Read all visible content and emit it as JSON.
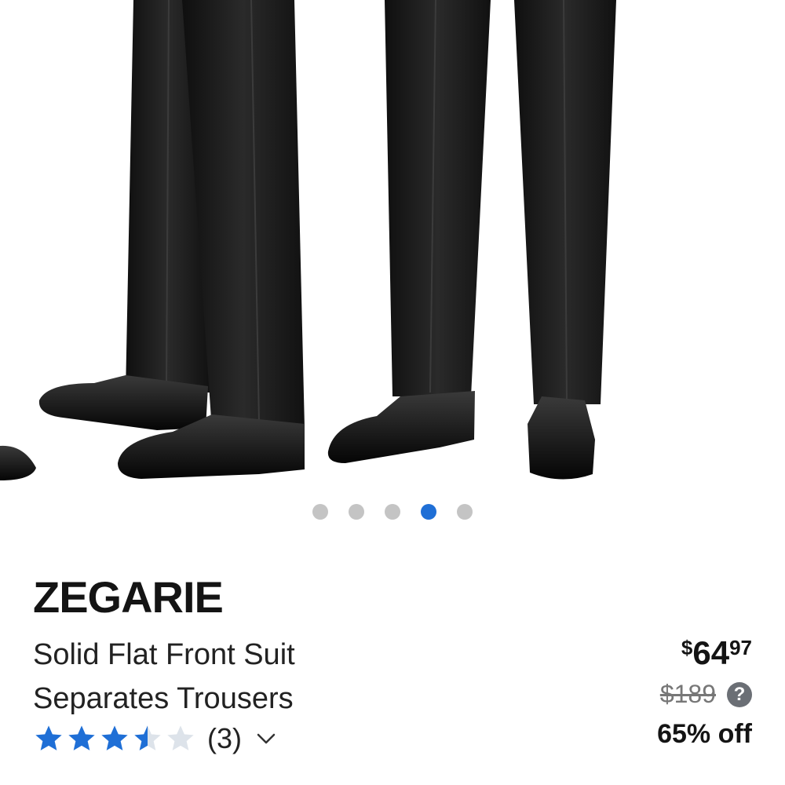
{
  "gallery": {
    "image_alt": "model wearing black trousers with wingtip shoes",
    "dot_count": 5,
    "active_index": 3
  },
  "product": {
    "brand": "ZEGARIE",
    "title_line1": "Solid Flat Front Suit",
    "title_line2": "Separates Trousers",
    "rating": 3.5,
    "rating_max": 5,
    "review_count": "(3)"
  },
  "pricing": {
    "currency": "$",
    "price_dollars": "64",
    "price_cents": "97",
    "original_price": "$189",
    "help_glyph": "?",
    "discount": "65% off"
  },
  "colors": {
    "accent": "#1f6fd6",
    "star_filled": "#1f6fd6",
    "star_empty": "#dde3ea",
    "dot_inactive": "#c4c4c4"
  },
  "icons": {
    "chevron": "chevron-down-icon",
    "help": "question-mark-icon"
  }
}
